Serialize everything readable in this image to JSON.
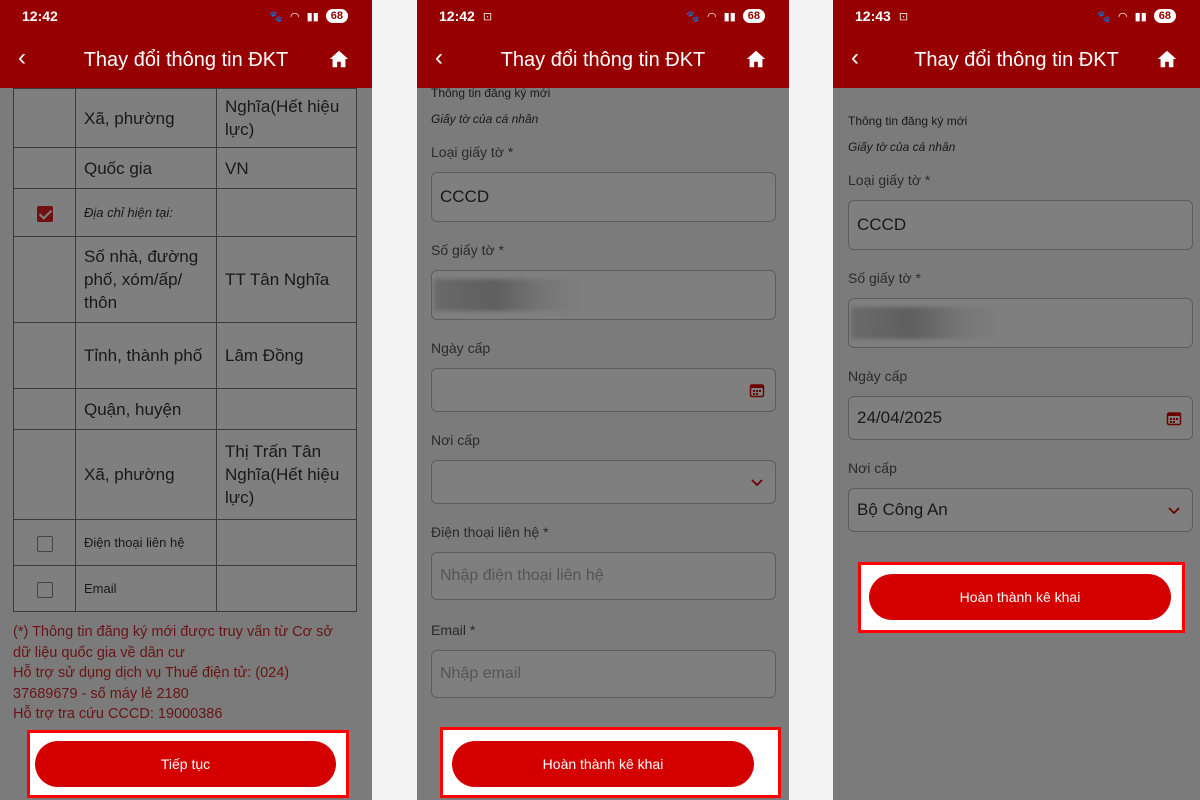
{
  "status": {
    "time1": "12:42",
    "time2": "12:42",
    "time3": "12:43",
    "battery": "68"
  },
  "appbar": {
    "title": "Thay đổi thông tin ĐKT"
  },
  "screen1": {
    "rows": [
      {
        "label": "Xã, phường",
        "value": "Nghĩa(Hết hiệu lực)"
      },
      {
        "label": "Quốc gia",
        "value": "VN"
      },
      {
        "label": "Địa chỉ hiện tại:",
        "value": ""
      },
      {
        "label": "Số nhà, đường phố, xóm/ấp/ thôn",
        "value": "TT Tân Nghĩa"
      },
      {
        "label": "Tỉnh, thành phố",
        "value": "Lâm Đồng"
      },
      {
        "label": "Quận, huyện",
        "value": ""
      },
      {
        "label": "Xã, phường",
        "value": "Thị Trấn Tân Nghĩa(Hết hiệu lực)"
      },
      {
        "label": "Điện thoại liên hệ",
        "value": ""
      },
      {
        "label": "Email",
        "value": ""
      }
    ],
    "note_lines": [
      "(*) Thông tin đăng ký mới được truy vấn từ Cơ sở",
      "dữ liệu quốc gia về dân cư",
      "Hỗ trợ sử dụng dịch vụ Thuế điện tử: (024)",
      "37689679 - số máy lẻ 2180",
      "Hỗ trợ tra cứu CCCD: 19000386"
    ],
    "continue_label": "Tiếp tục"
  },
  "form": {
    "section": "Thông tin đăng ký mới",
    "subsection": "Giấy tờ của cá nhân",
    "doc_type_label": "Loại giấy tờ *",
    "doc_type_value": "CCCD",
    "doc_number_label": "Số giấy tờ *",
    "issue_date_label": "Ngày cấp",
    "issue_place_label": "Nơi cấp",
    "phone_label": "Điện thoại liên hệ *",
    "phone_placeholder": "Nhập điện thoại liên hệ",
    "email_label": "Email *",
    "email_placeholder": "Nhập email",
    "complete_label": "Hoàn thành kê khai"
  },
  "screen3": {
    "issue_date_value": "24/04/2025",
    "issue_place_value": "Bộ Công An"
  },
  "colors": {
    "primary": "#970000",
    "button": "#d40000",
    "highlight": "#ff0000",
    "note": "#d42a2a"
  }
}
